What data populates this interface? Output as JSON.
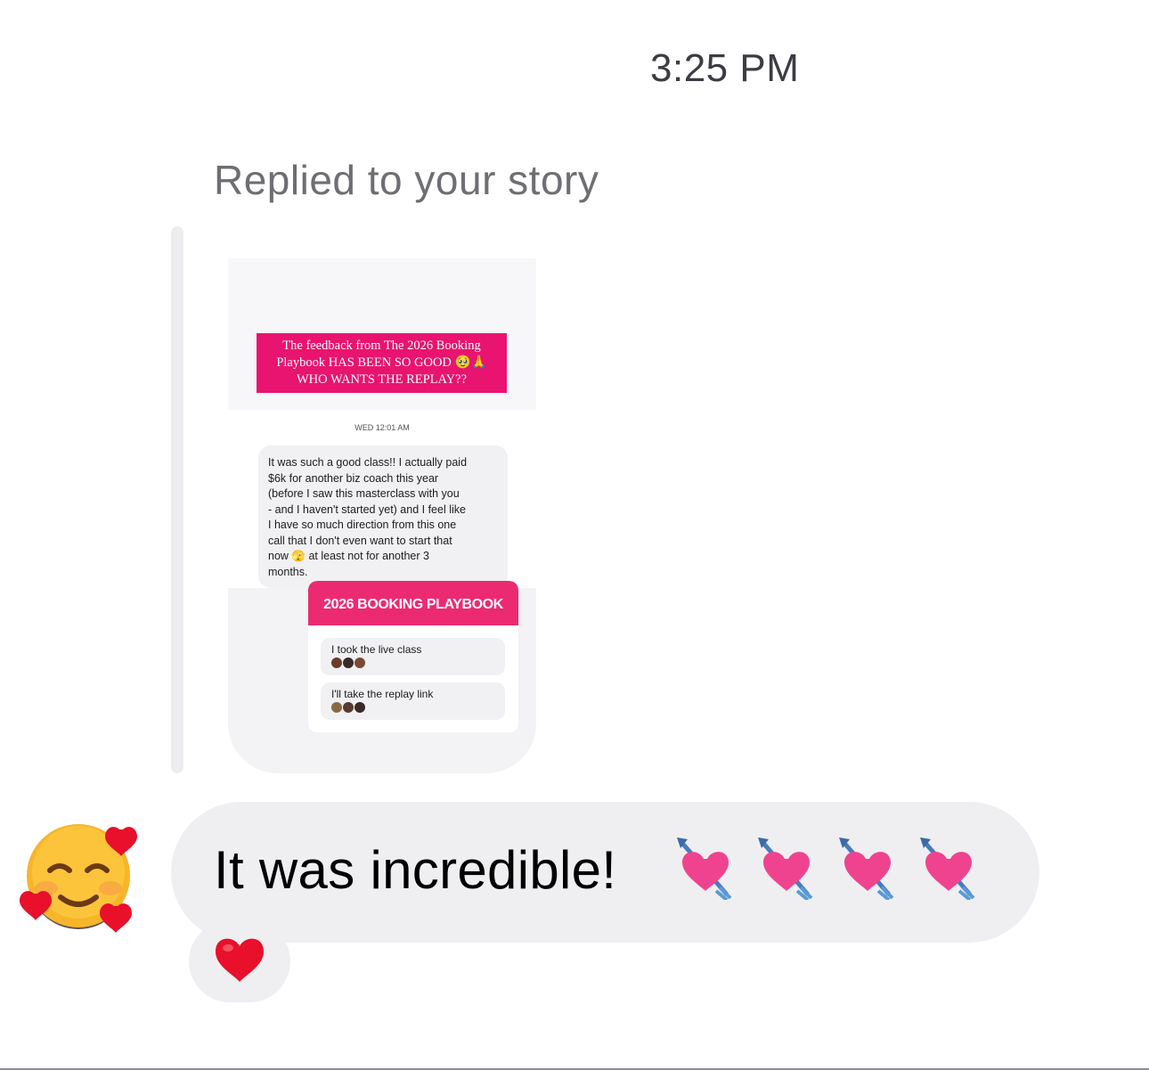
{
  "header": {
    "timestamp": "3:25 PM"
  },
  "reply": {
    "label": "Replied to your story"
  },
  "story": {
    "banner_lines": [
      "The feedback from The 2026 Booking",
      "Playbook HAS BEEN SO GOOD 🥹🙏",
      "WHO WANTS THE REPLAY??"
    ],
    "date": "WED 12:01 AM",
    "message_lines": [
      "It was such a good class!! I actually paid",
      "$6k for another biz coach this year",
      "(before I saw this masterclass with you",
      "- and I haven't started yet) and I feel like",
      "I have so much direction from this one",
      "call that I don't even want to start that",
      "now 🫣 at least not for another 3",
      "months."
    ],
    "poll": {
      "title": "2026 BOOKING PLAYBOOK",
      "options": [
        {
          "label": "I took the live class"
        },
        {
          "label": "I'll take the replay link"
        }
      ]
    }
  },
  "message": {
    "text": "It was incredible!",
    "emoji_icons": [
      "heart-with-arrow-icon",
      "heart-with-arrow-icon",
      "heart-with-arrow-icon",
      "heart-with-arrow-icon"
    ]
  },
  "reaction": {
    "icon": "red-heart-icon"
  },
  "avatar": {
    "icon": "smiling-face-with-hearts-icon"
  },
  "colors": {
    "banner_pink": "#e8146f",
    "poll_header_pink": "#ec2a72",
    "bubble_gray": "#efeff1",
    "heart_pink": "#f0438f",
    "heart_red": "#e8102a"
  }
}
